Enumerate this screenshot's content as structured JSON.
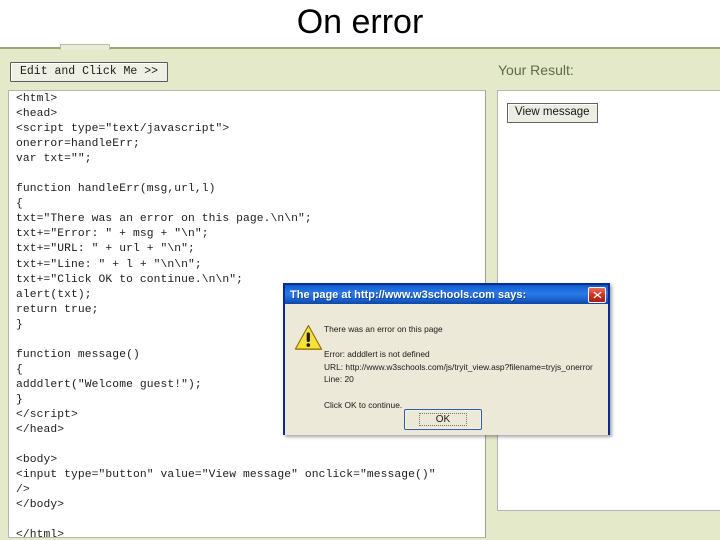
{
  "slide": {
    "title": "On error"
  },
  "tryit": {
    "edit_button_label": "Edit and Click Me >>",
    "result_heading": "Your Result:",
    "view_message_button_label": "View message",
    "code": "<html>\n<head>\n<script type=\"text/javascript\">\nonerror=handleErr;\nvar txt=\"\";\n\nfunction handleErr(msg,url,l)\n{\ntxt=\"There was an error on this page.\\n\\n\";\ntxt+=\"Error: \" + msg + \"\\n\";\ntxt+=\"URL: \" + url + \"\\n\";\ntxt+=\"Line: \" + l + \"\\n\\n\";\ntxt+=\"Click OK to continue.\\n\\n\";\nalert(txt);\nreturn true;\n}\n\nfunction message()\n{\nadddlert(\"Welcome guest!\");\n}\n</script>\n</head>\n\n<body>\n<input type=\"button\" value=\"View message\" onclick=\"message()\"\n/>\n</body>\n\n</html>"
  },
  "alert_dialog": {
    "title": "The page at http://www.w3schools.com says:",
    "icon": "warning-triangle-icon",
    "close_icon": "close-icon",
    "message": "There was an error on this page\n\nError: adddlert is not defined\nURL: http://www.w3schools.com/js/tryit_view.asp?filename=tryjs_onerror\nLine: 20\n\nClick OK to continue.",
    "ok_button_label": "OK"
  },
  "colors": {
    "panel_background": "#e3e9c9",
    "dialog_titlebar": "#1264d6",
    "dialog_body": "#ece9d8",
    "close_button": "#d0321c",
    "warning_yellow": "#f8e03c",
    "result_heading": "#5e6b4a"
  }
}
